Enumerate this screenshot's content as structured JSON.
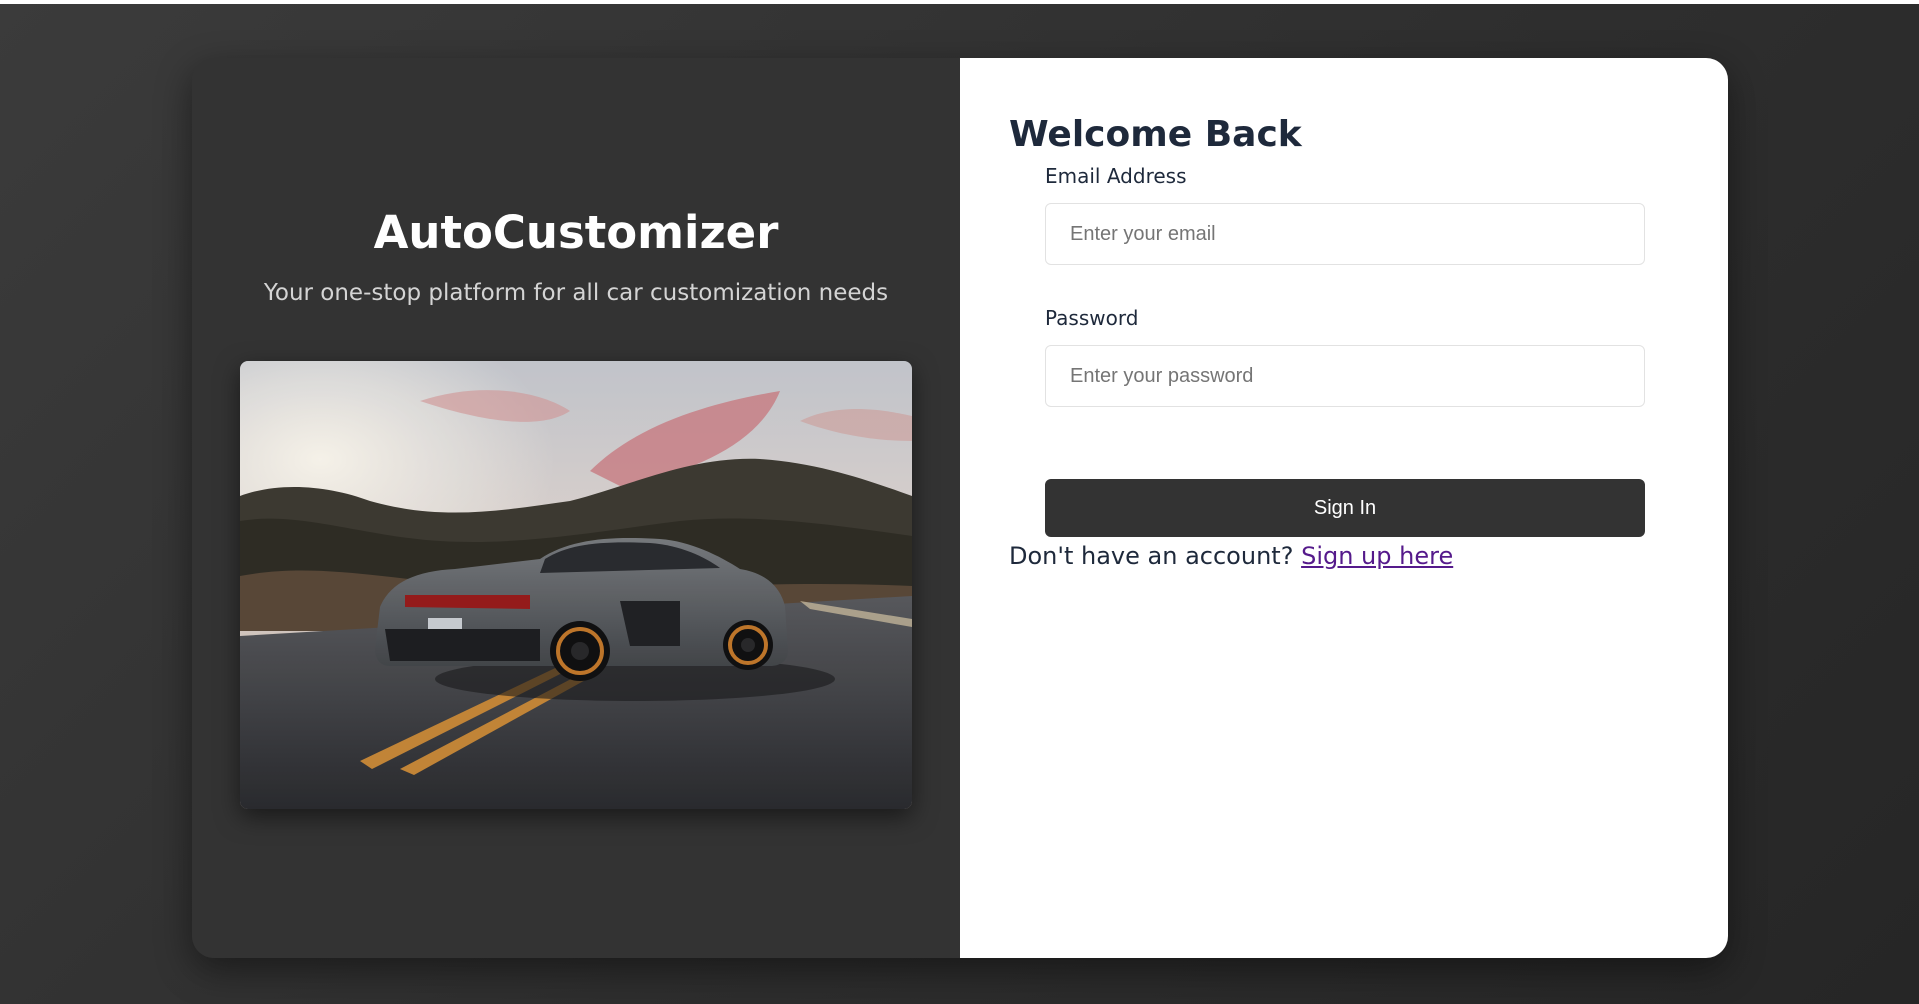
{
  "brand": {
    "title": "AutoCustomizer",
    "tagline": "Your one-stop platform for all car customization needs",
    "hero_image": "sports-car-on-mountain-road-image"
  },
  "login": {
    "title": "Welcome Back",
    "email": {
      "label": "Email Address",
      "placeholder": "Enter your email",
      "value": ""
    },
    "password": {
      "label": "Password",
      "placeholder": "Enter your password",
      "value": ""
    },
    "submit_label": "Sign In",
    "signup_prompt": "Don't have an account?",
    "signup_link": "Sign up here"
  },
  "colors": {
    "page_background": "#333333",
    "left_panel": "#333333",
    "right_panel": "#ffffff",
    "button": "#333333",
    "link": "#551a8b",
    "heading": "#1e293b"
  }
}
